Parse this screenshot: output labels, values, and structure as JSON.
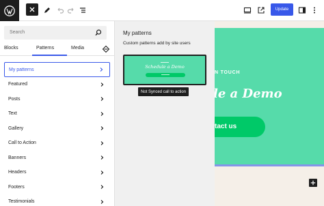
{
  "toolbar": {
    "close_label": "✕",
    "update_label": "Update"
  },
  "sidebar": {
    "search_placeholder": "Search",
    "tabs": [
      {
        "label": "Blocks"
      },
      {
        "label": "Patterns"
      },
      {
        "label": "Media"
      }
    ],
    "active_tab": "Patterns",
    "categories": [
      {
        "label": "My patterns",
        "active": true
      },
      {
        "label": "Featured"
      },
      {
        "label": "Posts"
      },
      {
        "label": "Text"
      },
      {
        "label": "Gallery"
      },
      {
        "label": "Call to Action"
      },
      {
        "label": "Banners"
      },
      {
        "label": "Headers"
      },
      {
        "label": "Footers"
      },
      {
        "label": "Testimonials"
      }
    ]
  },
  "pattern_panel": {
    "title": "My patterns",
    "subtitle": "Custom patterns add by site users",
    "preview": {
      "title": "Schedule a Demo"
    },
    "tooltip": "Not Synced call to action"
  },
  "canvas": {
    "eyebrow": "N TOUCH",
    "title": "le a Demo",
    "cta": "tact us"
  },
  "colors": {
    "accent": "#3858e9",
    "hero_bg": "#56dbaa",
    "cta_bg": "#00c968",
    "canvas_bg": "#f5efe8"
  }
}
